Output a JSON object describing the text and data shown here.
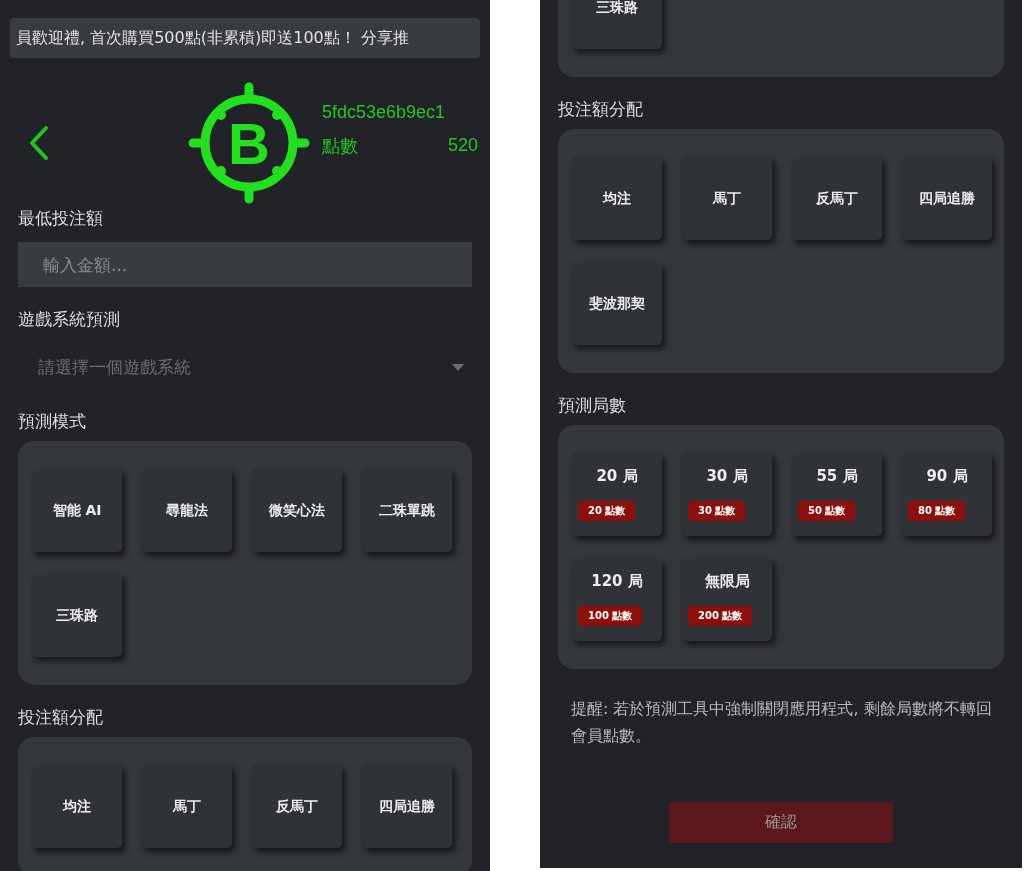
{
  "screens": [
    {
      "banner": "員歡迎禮, 首次購買500點(非累積)即送100點！ 分享推",
      "logo_letter": "B",
      "user_id": "5fdc53e6b9ec1",
      "points_label": "點數",
      "points_value": "520",
      "sections": [
        {
          "kind": "input",
          "label": "最低投注額",
          "placeholder": "輸入金額..."
        },
        {
          "kind": "select",
          "label": "遊戲系統預測",
          "placeholder": "請選擇一個遊戲系統"
        },
        {
          "kind": "options",
          "label": "預測模式",
          "items": [
            {
              "label": "智能 AI",
              "selected": false
            },
            {
              "label": "尋龍法",
              "selected": false
            },
            {
              "label": "微笑心法",
              "selected": false
            },
            {
              "label": "二珠單跳",
              "selected": false
            },
            {
              "label": "三珠路",
              "selected": false
            }
          ]
        },
        {
          "kind": "options",
          "label": "投注額分配",
          "items": [
            {
              "label": "均注",
              "selected": false
            },
            {
              "label": "馬丁",
              "selected": false
            },
            {
              "label": "反馬丁",
              "selected": false
            },
            {
              "label": "四局追勝",
              "selected": false
            }
          ]
        }
      ]
    },
    {
      "sections": [
        {
          "kind": "options",
          "items": [
            {
              "label": "三珠路",
              "selected": false
            }
          ]
        },
        {
          "kind": "options",
          "label": "投注額分配",
          "items": [
            {
              "label": "均注",
              "selected": false
            },
            {
              "label": "馬丁",
              "selected": false
            },
            {
              "label": "反馬丁",
              "selected": false
            },
            {
              "label": "四局追勝",
              "selected": false
            },
            {
              "label": "斐波那契",
              "selected": false
            }
          ]
        },
        {
          "kind": "rounds",
          "label": "預測局數",
          "items": [
            {
              "label": "20 局",
              "cost": "20 點數",
              "selected": false
            },
            {
              "label": "30 局",
              "cost": "30 點數",
              "selected": false
            },
            {
              "label": "55 局",
              "cost": "50 點數",
              "selected": false
            },
            {
              "label": "90 局",
              "cost": "80 點數",
              "selected": false
            },
            {
              "label": "120 局",
              "cost": "100 點數",
              "selected": false
            },
            {
              "label": "無限局",
              "cost": "200 點數",
              "selected": false
            }
          ]
        }
      ],
      "note": "提醒: 若於預測工具中強制關閉應用程式, 剩餘局數將不轉回會員點數。",
      "confirm": "確認"
    }
  ]
}
